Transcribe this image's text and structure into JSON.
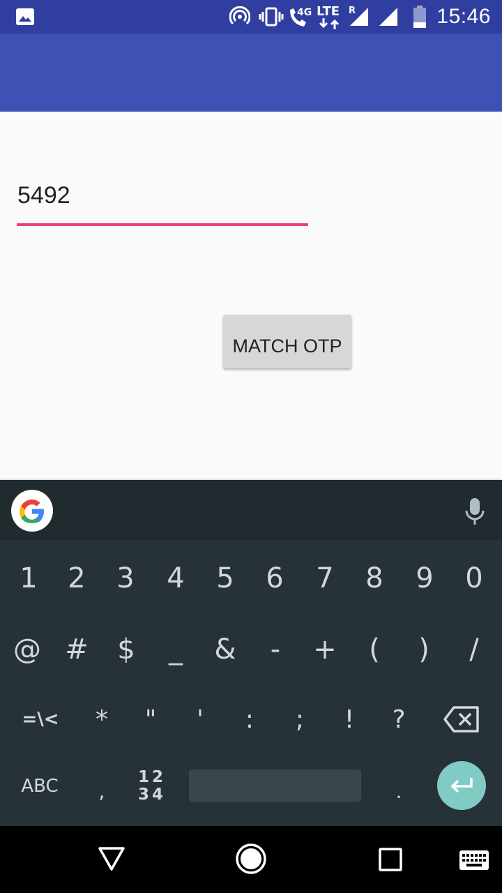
{
  "status_bar": {
    "notification_icon": "image-icon",
    "icons": [
      "hotspot-icon",
      "vibrate-icon",
      "volte-call-icon",
      "lte-signal-icon",
      "signal-icon",
      "battery-icon"
    ],
    "network_4g": "4G",
    "network_lte": "LTE",
    "roaming": "R",
    "time": "15:46"
  },
  "form": {
    "otp_value": "5492",
    "match_button_label": "MATCH OTP"
  },
  "keyboard": {
    "row1": [
      "1",
      "2",
      "3",
      "4",
      "5",
      "6",
      "7",
      "8",
      "9",
      "0"
    ],
    "row2": [
      "@",
      "#",
      "$",
      "_",
      "&",
      "-",
      "+",
      "(",
      ")",
      "/"
    ],
    "row3": [
      "=\\<",
      "*",
      "\"",
      "'",
      ":",
      ";",
      "!",
      "?"
    ],
    "abc_label": "ABC",
    "comma": ",",
    "numpad_label_top": "12",
    "numpad_label_bottom": "34",
    "period": "."
  },
  "colors": {
    "status_bar": "#303f9f",
    "app_bar": "#3f51b5",
    "input_underline": "#ec407a",
    "keyboard_bg": "#263238",
    "enter_key": "#80cbc4"
  }
}
